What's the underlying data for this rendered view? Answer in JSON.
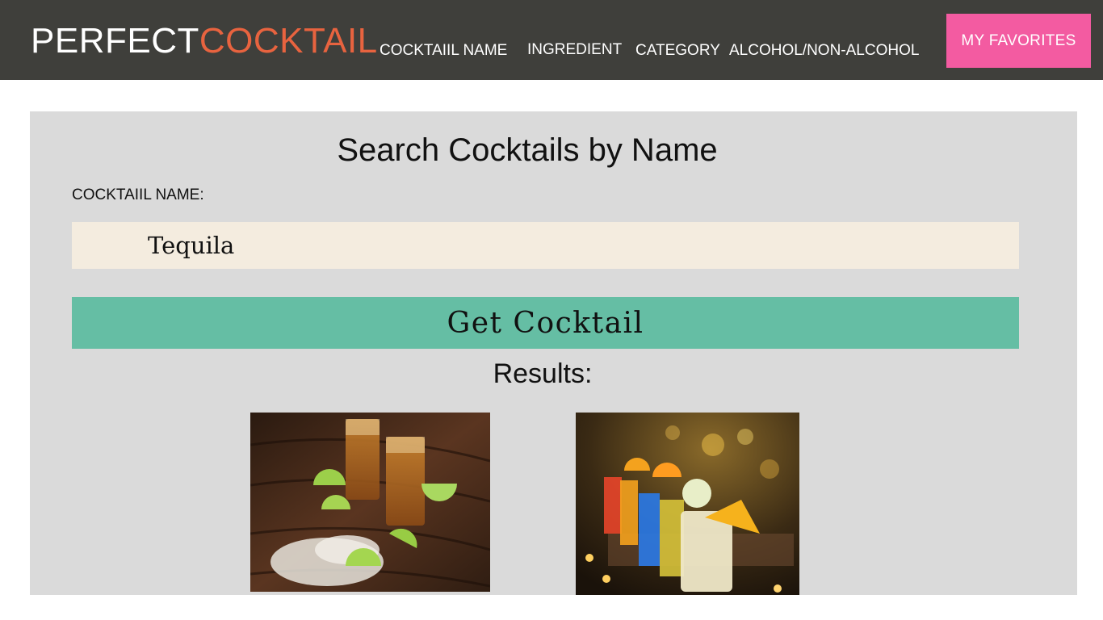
{
  "header": {
    "logo_part1": "PERFECT",
    "logo_part2": "COCKTAIL",
    "nav": [
      {
        "label": "COCKTAIIL NAME"
      },
      {
        "label": "INGREDIENT"
      },
      {
        "label": "CATEGORY"
      },
      {
        "label": "ALCOHOL/NON-ALCOHOL"
      }
    ],
    "favorites_label": "MY FAVORITES"
  },
  "search": {
    "title": "Search Cocktails by Name",
    "field_label": "COCKTAIIL NAME:",
    "input_value": "Tequila",
    "button_label": "Get Cocktail"
  },
  "results": {
    "label": "Results:",
    "items": [
      {
        "image": "tequila-shots-with-lime-and-salt-photo"
      },
      {
        "image": "colorful-layered-shots-with-fruit-photo"
      }
    ]
  },
  "colors": {
    "header_bg": "#3f3f3b",
    "accent": "#e8633f",
    "favorites_bg": "#f35ba1",
    "button_bg": "#65bea4",
    "input_bg": "#f4ecdf",
    "panel_bg": "#dadada"
  }
}
